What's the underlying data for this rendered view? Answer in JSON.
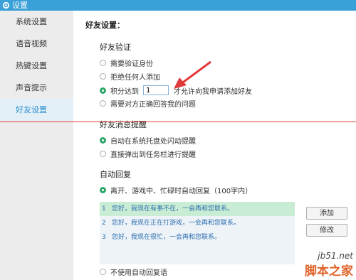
{
  "window": {
    "title": "设置"
  },
  "sidebar": {
    "items": [
      {
        "label": "系统设置",
        "active": false
      },
      {
        "label": "语音视频",
        "active": false
      },
      {
        "label": "热键设置",
        "active": false
      },
      {
        "label": "声音提示",
        "active": false
      },
      {
        "label": "好友设置",
        "active": true
      }
    ]
  },
  "main": {
    "section_title": "好友设置：",
    "verification": {
      "title": "好友验证",
      "options": [
        {
          "label": "需要验证身份",
          "checked": false
        },
        {
          "label": "拒绝任何人添加",
          "checked": false
        },
        {
          "label_before": "积分达到",
          "value": "1",
          "label_after": "才允许向我申请添加好友",
          "checked": true
        },
        {
          "label": "需要对方正确回答我的问题",
          "checked": false
        }
      ]
    },
    "message_reminder": {
      "title": "好友消息提醒",
      "options": [
        {
          "label": "自动在系统托盘处闪动提醒",
          "checked": true
        },
        {
          "label": "直接弹出到任务栏进行提醒",
          "checked": false
        }
      ]
    },
    "auto_reply": {
      "title": "自动回复",
      "option_on": "离开、游戏中、忙碌时自动回复（100字内）",
      "replies": [
        {
          "num": "1",
          "text": "您好，我现在有事不在，一会再和您联系。"
        },
        {
          "num": "2",
          "text": "您好，我现在正在打游戏，一会再和您联系。"
        },
        {
          "num": "3",
          "text": "您好，我现在很忙，一会再和您联系。"
        }
      ],
      "add_button": "添加",
      "edit_button": "修改",
      "option_off": "不使用自动回复语"
    }
  },
  "watermark": {
    "domain": "jb51.net",
    "name": "脚本之家"
  },
  "colors": {
    "titlebar": "#3aa0d8",
    "accent": "#2ca66a",
    "arrow": "#e23a3a",
    "link": "#2b6fb0"
  }
}
